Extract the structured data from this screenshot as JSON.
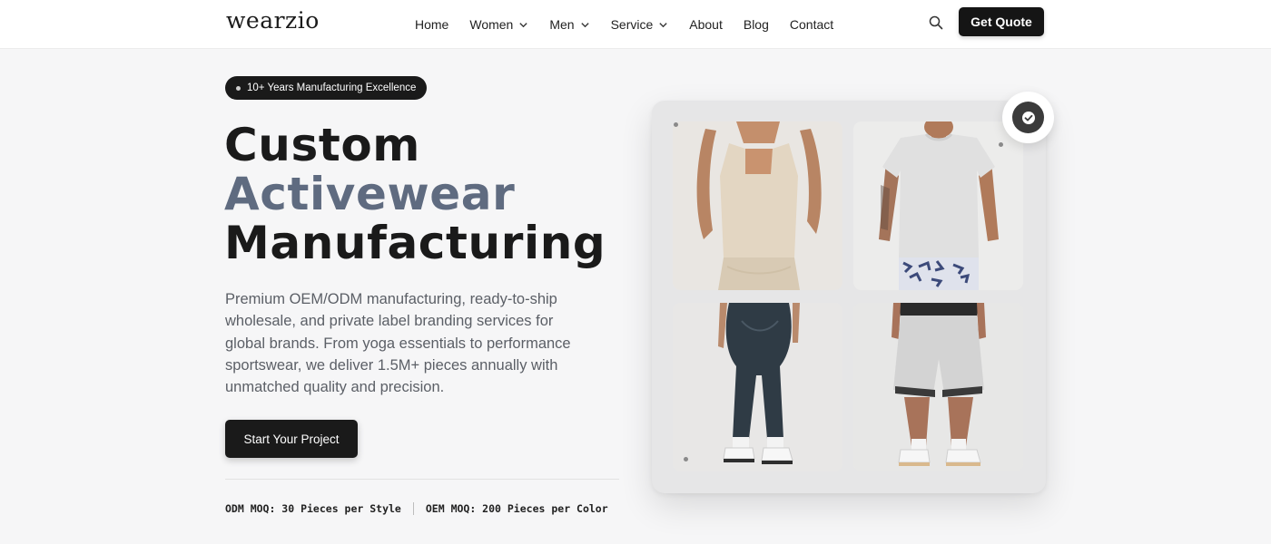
{
  "header": {
    "logo": "wearzio",
    "nav": [
      {
        "label": "Home",
        "dropdown": false
      },
      {
        "label": "Women",
        "dropdown": true
      },
      {
        "label": "Men",
        "dropdown": true
      },
      {
        "label": "Service",
        "dropdown": true
      },
      {
        "label": "About",
        "dropdown": false
      },
      {
        "label": "Blog",
        "dropdown": false
      },
      {
        "label": "Contact",
        "dropdown": false
      }
    ],
    "search_icon": "search-icon",
    "cta_label": "Get Quote"
  },
  "hero": {
    "badge": "10+ Years Manufacturing Excellence",
    "headline": {
      "line1": "Custom",
      "line2": "Activewear",
      "line3": "Manufacturing"
    },
    "description": "Premium OEM/ODM manufacturing, ready-to-ship wholesale, and private label branding services for global brands. From yoga essentials to performance sportswear, we deliver 1.5M+ pieces annually with unmatched quality and precision.",
    "cta_label": "Start Your Project",
    "moq": {
      "odm": "ODM MOQ: 30 Pieces per Style",
      "oem": "OEM MOQ: 200 Pieces per Color"
    }
  },
  "gallery": {
    "items": [
      {
        "name": "womens-tank-top-image"
      },
      {
        "name": "mens-tshirt-image"
      },
      {
        "name": "womens-leggings-image"
      },
      {
        "name": "mens-shorts-image"
      }
    ],
    "badge_icon": "check-circle-icon"
  },
  "colors": {
    "primary": "#1a1a1a",
    "accent": "#5f6b80",
    "background": "#f6f6f7",
    "text_muted": "#5b5f66"
  }
}
